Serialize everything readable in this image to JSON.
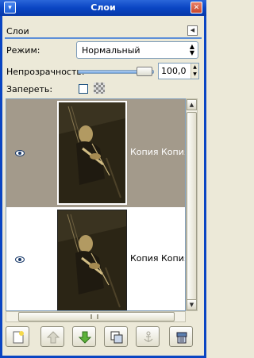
{
  "window": {
    "title": "Слои"
  },
  "panel": {
    "title": "Слои"
  },
  "mode": {
    "label": "Режим:",
    "value": "Нормальный"
  },
  "opacity": {
    "label": "Непрозрачность:",
    "value": "100,0",
    "level": 1.0
  },
  "lock": {
    "label": "Запереть:"
  },
  "layers": [
    {
      "name": "Копия Копия Копия",
      "visible": true,
      "selected": true
    },
    {
      "name": "Копия Копия Копия",
      "visible": true,
      "selected": false
    }
  ],
  "toolbar": {
    "buttons": [
      "new-layer-icon",
      "raise-layer-icon",
      "lower-layer-icon",
      "duplicate-layer-icon",
      "anchor-layer-icon",
      "delete-layer-icon"
    ]
  }
}
